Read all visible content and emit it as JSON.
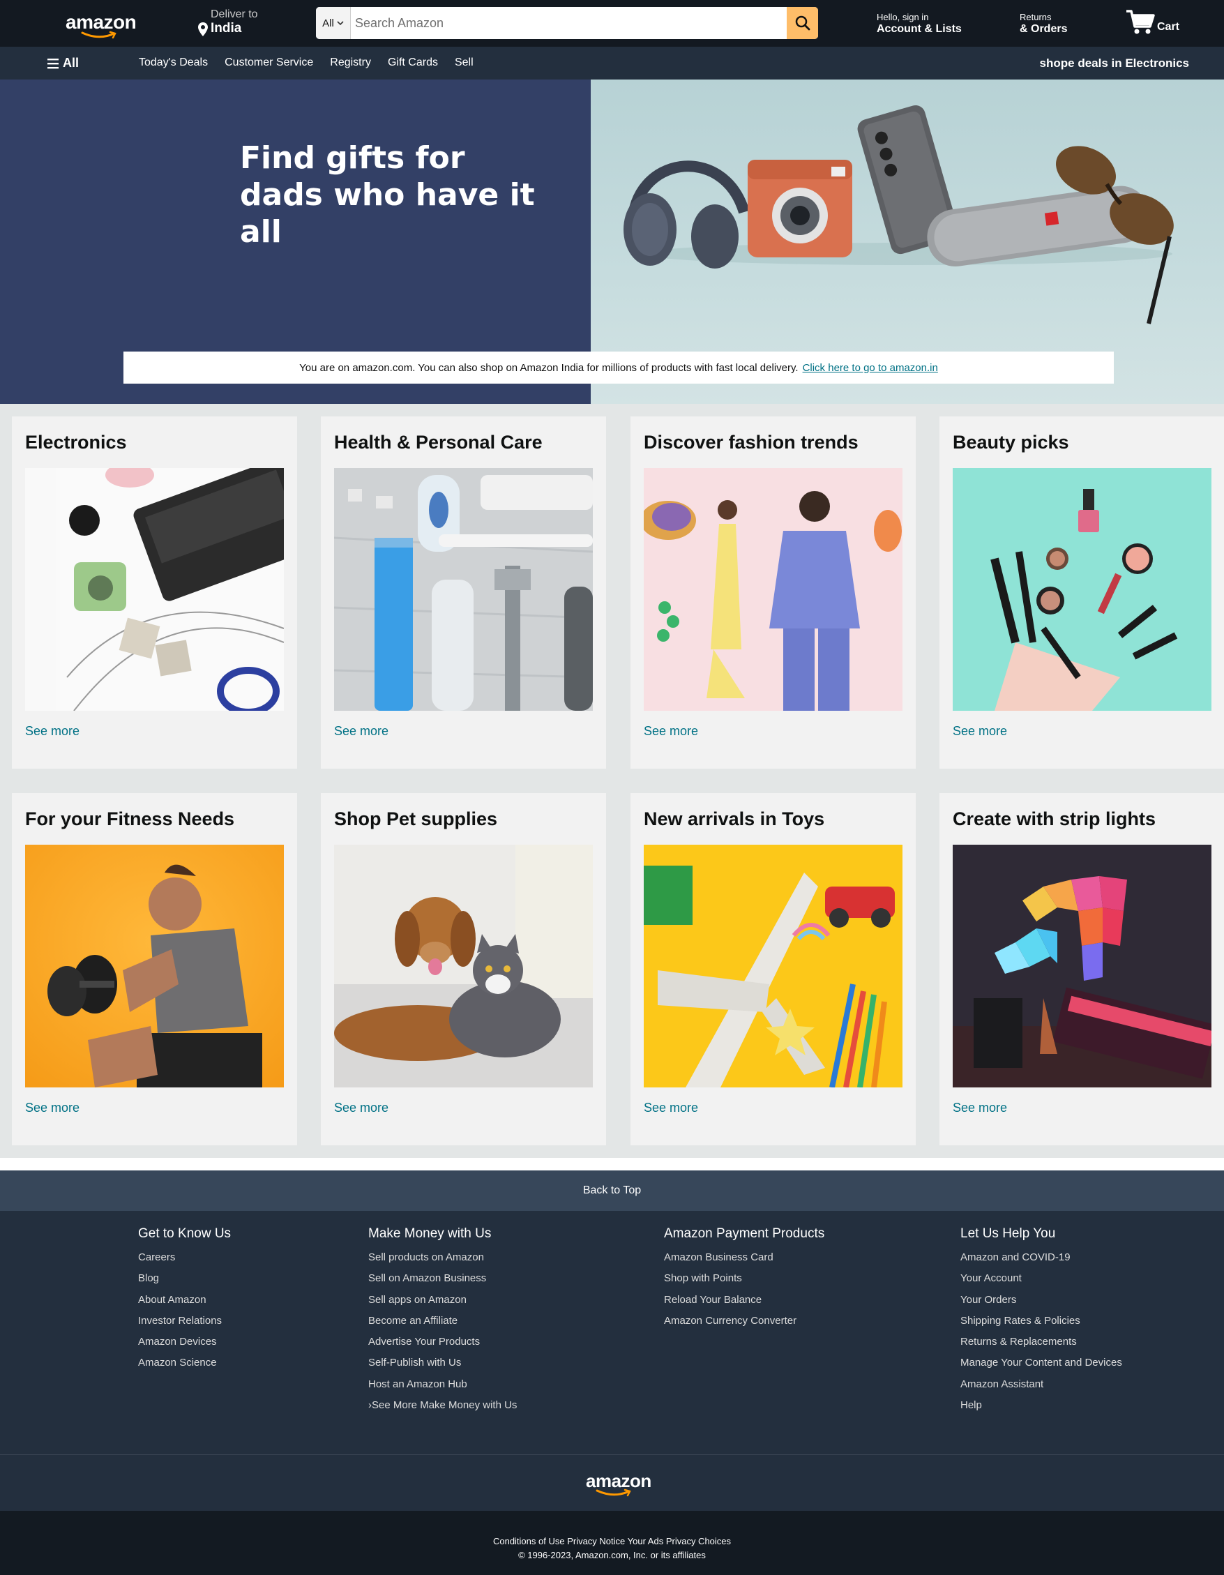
{
  "header": {
    "logo": "amazon",
    "deliver_line1": "Deliver to",
    "deliver_line2": "India",
    "search_category": "All",
    "search_placeholder": "Search Amazon",
    "signin_line1": "Hello, sign in",
    "signin_line2": "Account & Lists",
    "returns_line1": "Returns",
    "returns_line2": "& Orders",
    "cart_label": "Cart",
    "accent_color": "#febd69"
  },
  "subnav": {
    "all_label": "All",
    "links": [
      "Today's Deals",
      "Customer Service",
      "Registry",
      "Gift Cards",
      "Sell"
    ],
    "promo": "shope deals in Electronics"
  },
  "hero": {
    "title_line1": "Find gifts for",
    "title_line2": "dads who have it all",
    "notice_text": "You are on amazon.com. You can also shop on Amazon India for millions of products with fast local delivery.",
    "notice_link": "Click here to go to amazon.in"
  },
  "cards": [
    {
      "title": "Electronics",
      "see_more": "See more"
    },
    {
      "title": "Health & Personal Care",
      "see_more": "See more"
    },
    {
      "title": "Discover fashion trends",
      "see_more": "See more"
    },
    {
      "title": "Beauty picks",
      "see_more": "See more"
    },
    {
      "title": "For your Fitness Needs",
      "see_more": "See more"
    },
    {
      "title": "Shop Pet supplies",
      "see_more": "See more"
    },
    {
      "title": "New arrivals in Toys",
      "see_more": "See more"
    },
    {
      "title": "Create with strip lights",
      "see_more": "See more"
    }
  ],
  "footer": {
    "back_to_top": "Back to Top",
    "columns": [
      {
        "heading": "Get to Know Us",
        "links": [
          "Careers",
          "Blog",
          "About Amazon",
          "Investor Relations",
          "Amazon Devices",
          "Amazon Science"
        ]
      },
      {
        "heading": "Make Money with Us",
        "links": [
          "Sell products on Amazon",
          "Sell on Amazon Business",
          "Sell apps on Amazon",
          "Become an Affiliate",
          "Advertise Your Products",
          "Self-Publish with Us",
          "Host an Amazon Hub",
          "›See More Make Money with Us"
        ]
      },
      {
        "heading": "Amazon Payment Products",
        "links": [
          "Amazon Business Card",
          "Shop with Points",
          "Reload Your Balance",
          "Amazon Currency Converter"
        ]
      },
      {
        "heading": "Let Us Help You",
        "links": [
          "Amazon and COVID-19",
          "Your Account",
          "Your Orders",
          "Shipping Rates & Policies",
          "Returns & Replacements",
          "Manage Your Content and Devices",
          "Amazon Assistant",
          "Help"
        ]
      }
    ],
    "logo": "amazon",
    "bottom_links": "Conditions of Use Privacy Notice Your Ads Privacy Choices",
    "copyright": "© 1996-2023, Amazon.com, Inc. or its affiliates"
  }
}
